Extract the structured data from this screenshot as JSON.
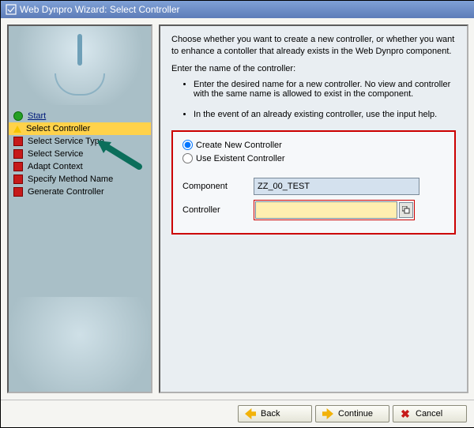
{
  "window": {
    "title": "Web Dynpro Wizard: Select Controller"
  },
  "sidebar": {
    "steps": [
      {
        "label": "Start",
        "state": "visited"
      },
      {
        "label": "Select Controller",
        "state": "active"
      },
      {
        "label": "Select Service Type",
        "state": "pending"
      },
      {
        "label": "Select Service",
        "state": "pending"
      },
      {
        "label": "Adapt Context",
        "state": "pending"
      },
      {
        "label": "Specify Method Name",
        "state": "pending"
      },
      {
        "label": "Generate Controller",
        "state": "pending"
      }
    ]
  },
  "main": {
    "intro1": "Choose whether you want to create a new controller, or whether you want to enhance a contoller that already exists in the Web Dynpro component.",
    "intro2": "Enter the name of the controller:",
    "bullets": [
      "Enter the desired name for a new controller. No view and controller with the same name is allowed to exist in the component.",
      "In the event of an already existing controller, use the input help."
    ],
    "radio": {
      "create": {
        "label": "Create New Controller",
        "checked": true
      },
      "existent": {
        "label": "Use Existent Controller",
        "checked": false
      }
    },
    "fields": {
      "component_label": "Component",
      "component_value": "ZZ_00_TEST",
      "controller_label": "Controller",
      "controller_value": ""
    }
  },
  "footer": {
    "back": "Back",
    "continue": "Continue",
    "cancel": "Cancel"
  }
}
